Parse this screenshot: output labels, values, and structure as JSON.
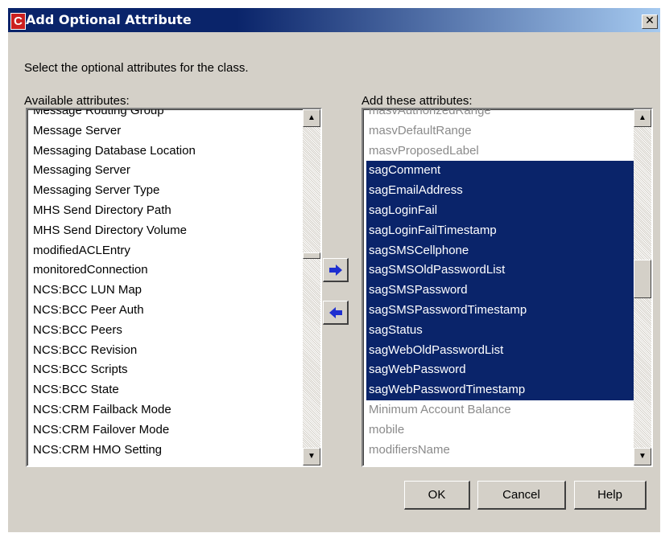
{
  "window": {
    "title": "Add Optional Attribute",
    "app_icon_letter": "C",
    "close_glyph": "✕"
  },
  "instruction": "Select the optional attributes for the class.",
  "available": {
    "label": "Available attributes:",
    "items": [
      "Message Routing Group",
      "Message Server",
      "Messaging Database Location",
      "Messaging Server",
      "Messaging Server Type",
      "MHS Send Directory Path",
      "MHS Send Directory Volume",
      "modifiedACLEntry",
      "monitoredConnection",
      "NCS:BCC LUN Map",
      "NCS:BCC Peer Auth",
      "NCS:BCC Peers",
      "NCS:BCC Revision",
      "NCS:BCC Scripts",
      "NCS:BCC State",
      "NCS:CRM Failback Mode",
      "NCS:CRM Failover Mode",
      "NCS:CRM HMO Setting"
    ]
  },
  "add": {
    "label": "Add these attributes:",
    "items": [
      {
        "text": "masvAuthorizedRange",
        "state": "disabled"
      },
      {
        "text": "masvDefaultRange",
        "state": "disabled"
      },
      {
        "text": "masvProposedLabel",
        "state": "disabled"
      },
      {
        "text": "sagComment",
        "state": "selected"
      },
      {
        "text": "sagEmailAddress",
        "state": "selected"
      },
      {
        "text": "sagLoginFail",
        "state": "selected"
      },
      {
        "text": "sagLoginFailTimestamp",
        "state": "selected"
      },
      {
        "text": "sagSMSCellphone",
        "state": "selected"
      },
      {
        "text": "sagSMSOldPasswordList",
        "state": "selected"
      },
      {
        "text": "sagSMSPassword",
        "state": "selected"
      },
      {
        "text": "sagSMSPasswordTimestamp",
        "state": "selected"
      },
      {
        "text": "sagStatus",
        "state": "selected"
      },
      {
        "text": "sagWebOldPasswordList",
        "state": "selected"
      },
      {
        "text": "sagWebPassword",
        "state": "selected"
      },
      {
        "text": "sagWebPasswordTimestamp",
        "state": "selected"
      },
      {
        "text": "Minimum Account Balance",
        "state": "disabled"
      },
      {
        "text": "mobile",
        "state": "disabled"
      },
      {
        "text": "modifiersName",
        "state": "disabled"
      }
    ]
  },
  "move_buttons": {
    "add_icon": "arrow-right-icon",
    "remove_icon": "arrow-left-icon",
    "arrow_color": "#1e2fd0"
  },
  "buttons": {
    "ok": "OK",
    "cancel": "Cancel",
    "help": "Help"
  },
  "colors": {
    "dialog_bg": "#d4d0c8",
    "title_bar": "#0a246a",
    "selection": "#0a246a",
    "disabled_text": "#8a8a8a"
  }
}
